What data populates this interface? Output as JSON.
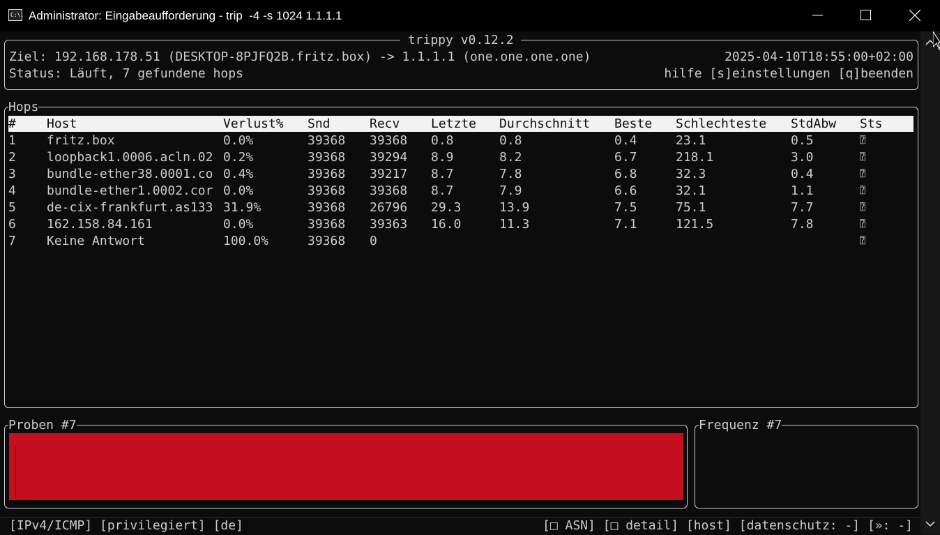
{
  "window": {
    "title": "Administrator: Eingabeaufforderung - trip  -4 -s 1024 1.1.1.1",
    "icon": "console-icon",
    "icon_text": "C:\\."
  },
  "header": {
    "app_title": " trippy v0.12.2 ",
    "target_line": "Ziel: 192.168.178.51 (DESKTOP-8PJFQ2B.fritz.box) -> 1.1.1.1 (one.one.one.one)",
    "timestamp": "2025-04-10T18:55:00+02:00",
    "status_line": "Status: Läuft, 7 gefundene hops",
    "help_line": "hilfe [s]einstellungen [q]beenden"
  },
  "hops": {
    "title": "Hops",
    "columns": [
      "#",
      "Host",
      "Verlust%",
      "Snd",
      "Recv",
      "Letzte",
      "Durchschnitt",
      "Beste",
      "Schlechteste",
      "StdAbw",
      "Sts"
    ],
    "rows": [
      [
        "1",
        "fritz.box",
        "0.0%",
        "39368",
        "39368",
        "0.8",
        "0.8",
        "0.4",
        "23.1",
        "0.5",
        "⍰"
      ],
      [
        "2",
        "loopback1.0006.acln.02",
        "0.2%",
        "39368",
        "39294",
        "8.9",
        "8.2",
        "6.7",
        "218.1",
        "3.0",
        "⍰"
      ],
      [
        "3",
        "bundle-ether38.0001.co",
        "0.4%",
        "39368",
        "39217",
        "8.7",
        "7.8",
        "6.8",
        "32.3",
        "0.4",
        "⍰"
      ],
      [
        "4",
        "bundle-ether1.0002.cor",
        "0.0%",
        "39368",
        "39368",
        "8.7",
        "7.9",
        "6.6",
        "32.1",
        "1.1",
        "⍰"
      ],
      [
        "5",
        "de-cix-frankfurt.as133",
        "31.9%",
        "39368",
        "26796",
        "29.3",
        "13.9",
        "7.5",
        "75.1",
        "7.7",
        "⍰"
      ],
      [
        "6",
        "162.158.84.161",
        "0.0%",
        "39368",
        "39363",
        "16.0",
        "11.3",
        "7.1",
        "121.5",
        "7.8",
        "⍰"
      ],
      [
        "7",
        "Keine Antwort",
        "100.0%",
        "39368",
        "0",
        "",
        "",
        "",
        "",
        "",
        "⍰"
      ]
    ]
  },
  "probes": {
    "title": "Proben #7",
    "loss_fraction": 1.0,
    "color": "#c50f1f"
  },
  "frequency": {
    "title": "Frequenz #7"
  },
  "statusbar": {
    "left": "[IPv4/ICMP] [privilegiert] [de]",
    "right": "[□ ASN] [□ detail] [host] [datenschutz: -] [»: -]"
  },
  "colors": {
    "background": "#0c0c0c",
    "foreground": "#cccccc",
    "header_row_bg": "#f2f2f2",
    "probe_fill": "#c50f1f"
  }
}
